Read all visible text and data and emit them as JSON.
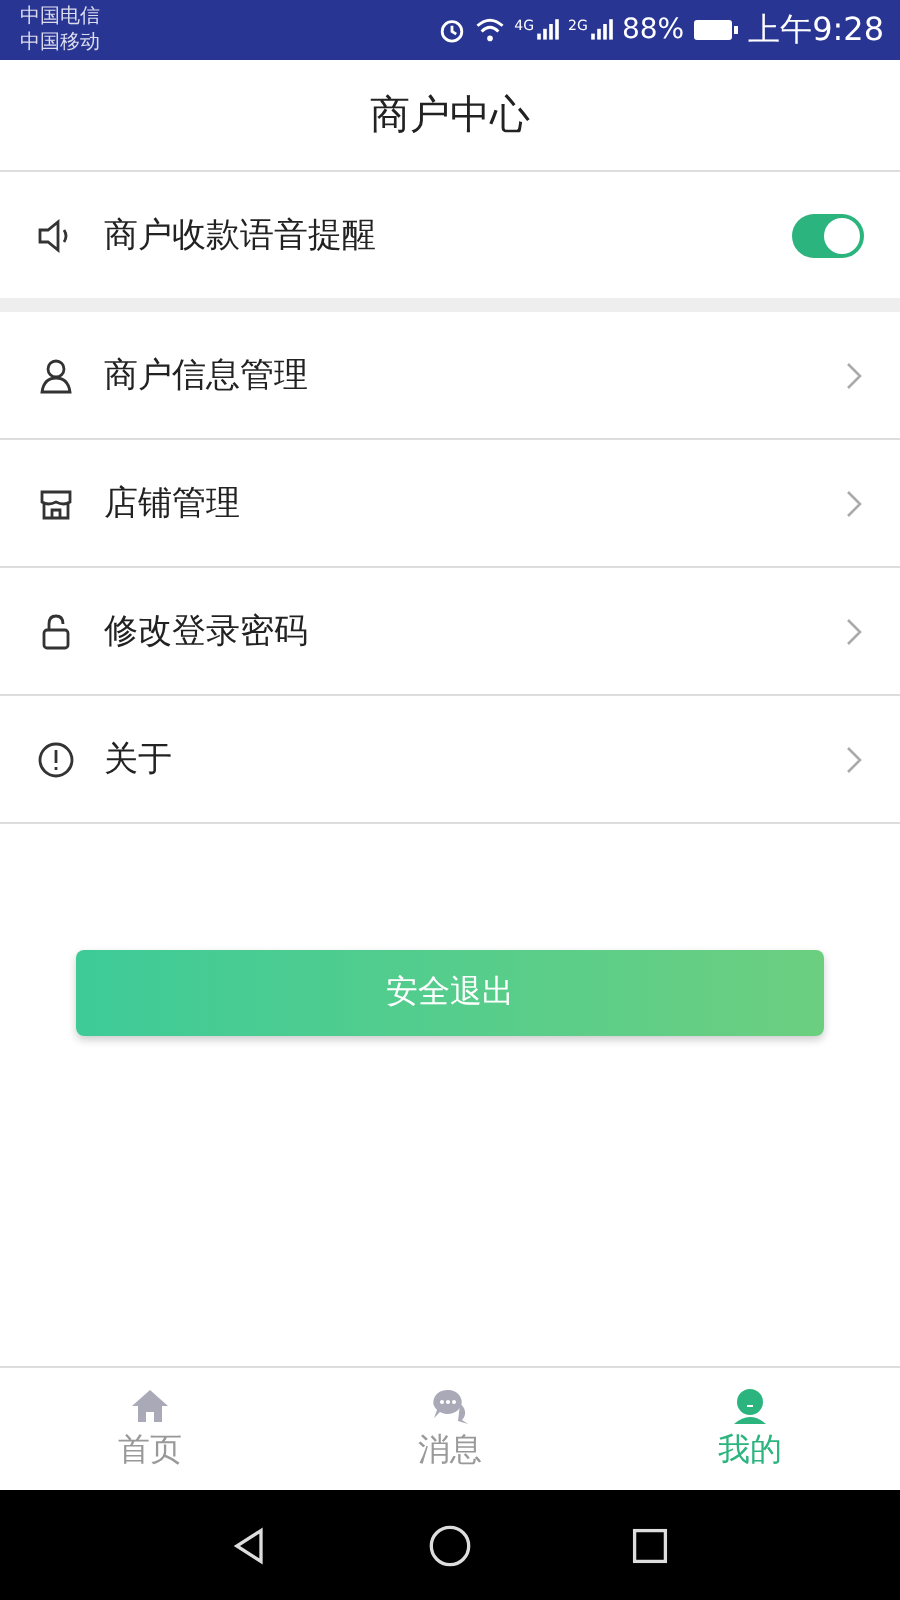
{
  "status_bar": {
    "carriers": [
      "中国电信",
      "中国移动"
    ],
    "networks": [
      "4G",
      "2G"
    ],
    "battery": "88%",
    "time": "上午9:28"
  },
  "header": {
    "title": "商户中心"
  },
  "voice_reminder": {
    "label": "商户收款语音提醒",
    "on": true
  },
  "menu": [
    {
      "kind": "person",
      "label": "商户信息管理"
    },
    {
      "kind": "store",
      "label": "店铺管理"
    },
    {
      "kind": "lock",
      "label": "修改登录密码"
    },
    {
      "kind": "info",
      "label": "关于"
    }
  ],
  "logout_button": {
    "label": "安全退出"
  },
  "tabs": [
    {
      "kind": "home",
      "label": "首页",
      "selected": false
    },
    {
      "kind": "message",
      "label": "消息",
      "selected": false
    },
    {
      "kind": "me",
      "label": "我的",
      "selected": true
    }
  ]
}
